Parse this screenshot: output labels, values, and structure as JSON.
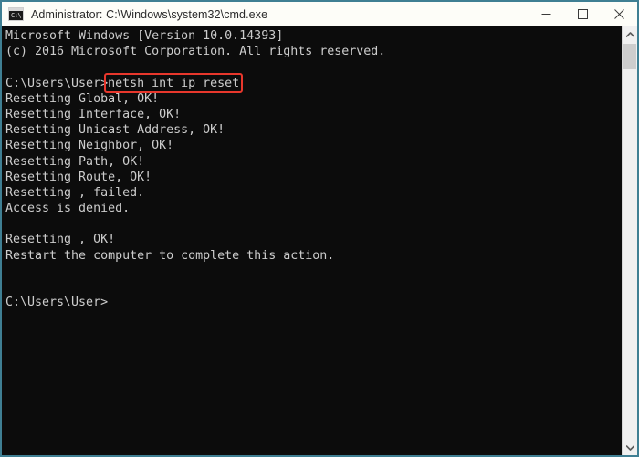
{
  "window": {
    "title": "Administrator: C:\\Windows\\system32\\cmd.exe",
    "icon_name": "cmd-console-icon",
    "icon_glyph": "C:\\",
    "border_color": "#3f7f93",
    "titlebar_bg": "#fdfdf8",
    "console_bg": "#0c0c0c",
    "console_fg": "#cccccc"
  },
  "controls": {
    "minimize_label": "Minimize",
    "maximize_label": "Maximize",
    "close_label": "Close"
  },
  "console": {
    "lines": [
      "Microsoft Windows [Version 10.0.14393]",
      "(c) 2016 Microsoft Corporation. All rights reserved.",
      "",
      "C:\\Users\\User>netsh int ip reset",
      "Resetting Global, OK!",
      "Resetting Interface, OK!",
      "Resetting Unicast Address, OK!",
      "Resetting Neighbor, OK!",
      "Resetting Path, OK!",
      "Resetting Route, OK!",
      "Resetting , failed.",
      "Access is denied.",
      "",
      "Resetting , OK!",
      "Restart the computer to complete this action.",
      "",
      "",
      "C:\\Users\\User>"
    ]
  },
  "highlight": {
    "text": "netsh int ip reset",
    "color": "#e8372c"
  },
  "scrollbar": {
    "up_arrow": "scroll-up-arrow",
    "down_arrow": "scroll-down-arrow",
    "thumb": "scroll-thumb"
  }
}
